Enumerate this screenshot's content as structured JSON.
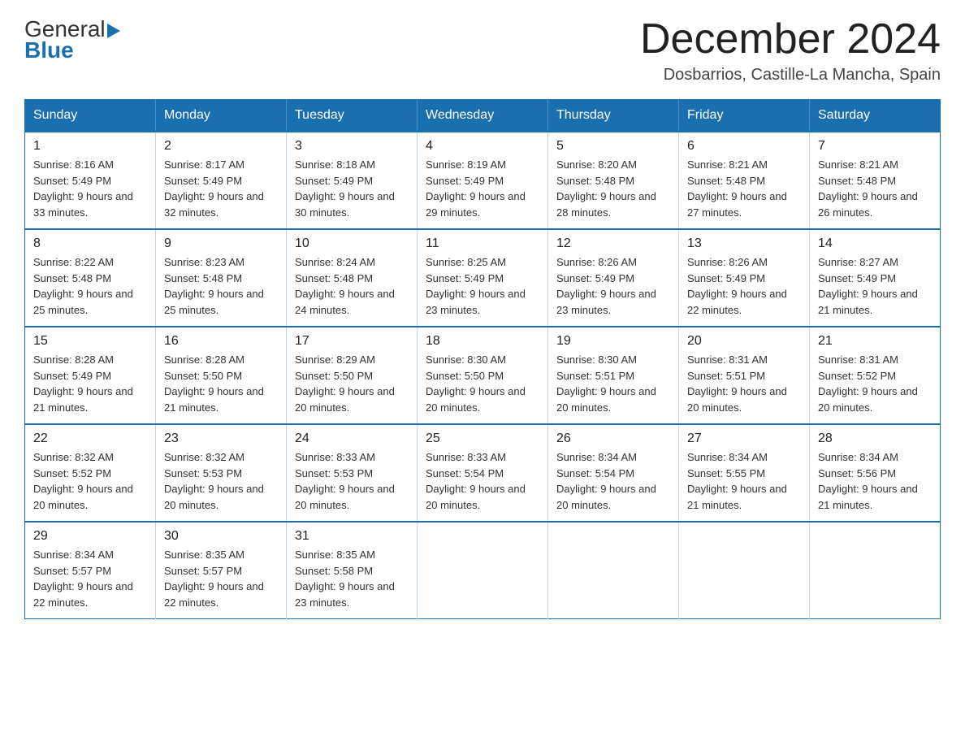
{
  "header": {
    "logo_general": "General",
    "logo_blue": "Blue",
    "month_title": "December 2024",
    "location": "Dosbarrios, Castille-La Mancha, Spain"
  },
  "days_of_week": [
    "Sunday",
    "Monday",
    "Tuesday",
    "Wednesday",
    "Thursday",
    "Friday",
    "Saturday"
  ],
  "weeks": [
    [
      {
        "day": "1",
        "sunrise": "8:16 AM",
        "sunset": "5:49 PM",
        "daylight": "9 hours and 33 minutes."
      },
      {
        "day": "2",
        "sunrise": "8:17 AM",
        "sunset": "5:49 PM",
        "daylight": "9 hours and 32 minutes."
      },
      {
        "day": "3",
        "sunrise": "8:18 AM",
        "sunset": "5:49 PM",
        "daylight": "9 hours and 30 minutes."
      },
      {
        "day": "4",
        "sunrise": "8:19 AM",
        "sunset": "5:49 PM",
        "daylight": "9 hours and 29 minutes."
      },
      {
        "day": "5",
        "sunrise": "8:20 AM",
        "sunset": "5:48 PM",
        "daylight": "9 hours and 28 minutes."
      },
      {
        "day": "6",
        "sunrise": "8:21 AM",
        "sunset": "5:48 PM",
        "daylight": "9 hours and 27 minutes."
      },
      {
        "day": "7",
        "sunrise": "8:21 AM",
        "sunset": "5:48 PM",
        "daylight": "9 hours and 26 minutes."
      }
    ],
    [
      {
        "day": "8",
        "sunrise": "8:22 AM",
        "sunset": "5:48 PM",
        "daylight": "9 hours and 25 minutes."
      },
      {
        "day": "9",
        "sunrise": "8:23 AM",
        "sunset": "5:48 PM",
        "daylight": "9 hours and 25 minutes."
      },
      {
        "day": "10",
        "sunrise": "8:24 AM",
        "sunset": "5:48 PM",
        "daylight": "9 hours and 24 minutes."
      },
      {
        "day": "11",
        "sunrise": "8:25 AM",
        "sunset": "5:49 PM",
        "daylight": "9 hours and 23 minutes."
      },
      {
        "day": "12",
        "sunrise": "8:26 AM",
        "sunset": "5:49 PM",
        "daylight": "9 hours and 23 minutes."
      },
      {
        "day": "13",
        "sunrise": "8:26 AM",
        "sunset": "5:49 PM",
        "daylight": "9 hours and 22 minutes."
      },
      {
        "day": "14",
        "sunrise": "8:27 AM",
        "sunset": "5:49 PM",
        "daylight": "9 hours and 21 minutes."
      }
    ],
    [
      {
        "day": "15",
        "sunrise": "8:28 AM",
        "sunset": "5:49 PM",
        "daylight": "9 hours and 21 minutes."
      },
      {
        "day": "16",
        "sunrise": "8:28 AM",
        "sunset": "5:50 PM",
        "daylight": "9 hours and 21 minutes."
      },
      {
        "day": "17",
        "sunrise": "8:29 AM",
        "sunset": "5:50 PM",
        "daylight": "9 hours and 20 minutes."
      },
      {
        "day": "18",
        "sunrise": "8:30 AM",
        "sunset": "5:50 PM",
        "daylight": "9 hours and 20 minutes."
      },
      {
        "day": "19",
        "sunrise": "8:30 AM",
        "sunset": "5:51 PM",
        "daylight": "9 hours and 20 minutes."
      },
      {
        "day": "20",
        "sunrise": "8:31 AM",
        "sunset": "5:51 PM",
        "daylight": "9 hours and 20 minutes."
      },
      {
        "day": "21",
        "sunrise": "8:31 AM",
        "sunset": "5:52 PM",
        "daylight": "9 hours and 20 minutes."
      }
    ],
    [
      {
        "day": "22",
        "sunrise": "8:32 AM",
        "sunset": "5:52 PM",
        "daylight": "9 hours and 20 minutes."
      },
      {
        "day": "23",
        "sunrise": "8:32 AM",
        "sunset": "5:53 PM",
        "daylight": "9 hours and 20 minutes."
      },
      {
        "day": "24",
        "sunrise": "8:33 AM",
        "sunset": "5:53 PM",
        "daylight": "9 hours and 20 minutes."
      },
      {
        "day": "25",
        "sunrise": "8:33 AM",
        "sunset": "5:54 PM",
        "daylight": "9 hours and 20 minutes."
      },
      {
        "day": "26",
        "sunrise": "8:34 AM",
        "sunset": "5:54 PM",
        "daylight": "9 hours and 20 minutes."
      },
      {
        "day": "27",
        "sunrise": "8:34 AM",
        "sunset": "5:55 PM",
        "daylight": "9 hours and 21 minutes."
      },
      {
        "day": "28",
        "sunrise": "8:34 AM",
        "sunset": "5:56 PM",
        "daylight": "9 hours and 21 minutes."
      }
    ],
    [
      {
        "day": "29",
        "sunrise": "8:34 AM",
        "sunset": "5:57 PM",
        "daylight": "9 hours and 22 minutes."
      },
      {
        "day": "30",
        "sunrise": "8:35 AM",
        "sunset": "5:57 PM",
        "daylight": "9 hours and 22 minutes."
      },
      {
        "day": "31",
        "sunrise": "8:35 AM",
        "sunset": "5:58 PM",
        "daylight": "9 hours and 23 minutes."
      },
      null,
      null,
      null,
      null
    ]
  ]
}
